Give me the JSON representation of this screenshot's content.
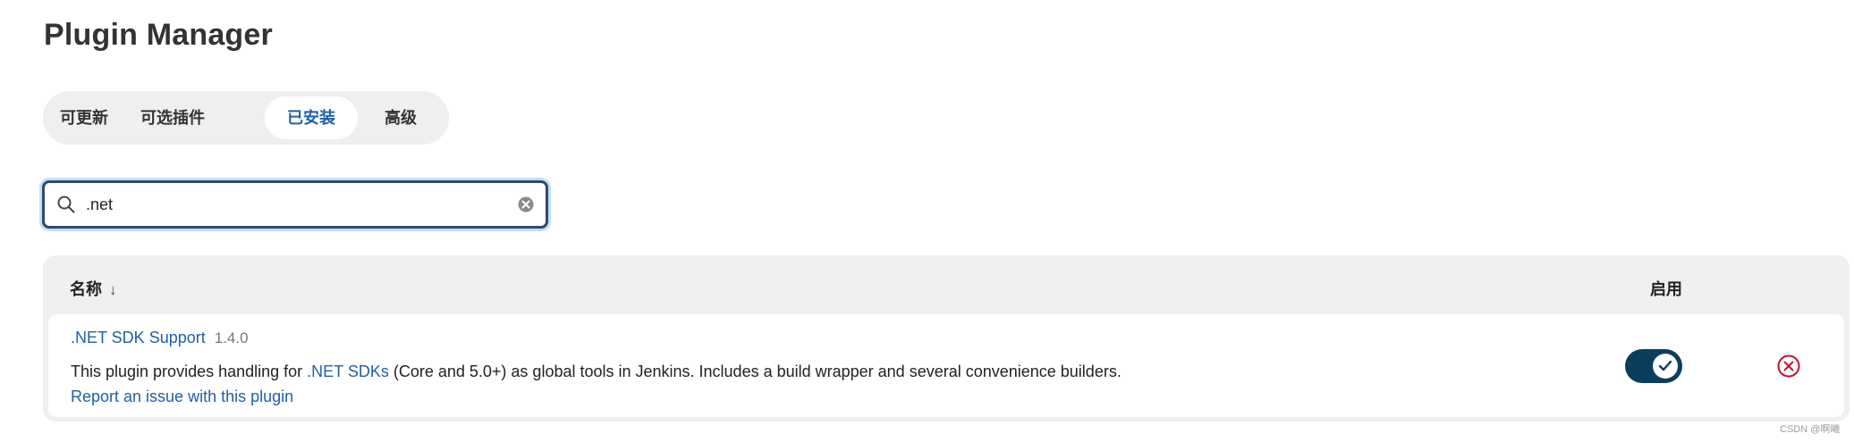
{
  "page": {
    "title": "Plugin Manager"
  },
  "tabs": [
    {
      "label": "可更新",
      "active": false
    },
    {
      "label": "可选插件",
      "active": false
    },
    {
      "label": "已安装",
      "active": true
    },
    {
      "label": "高级",
      "active": false
    }
  ],
  "search": {
    "value": ".net",
    "placeholder": ""
  },
  "table": {
    "headers": {
      "name": "名称",
      "sort_indicator": "↓",
      "enabled": "启用"
    },
    "rows": [
      {
        "name": ".NET SDK Support",
        "version": "1.4.0",
        "description_before": "This plugin provides handling for ",
        "description_link": ".NET SDKs",
        "description_after": " (Core and 5.0+) as global tools in Jenkins. Includes a build wrapper and several convenience builders.",
        "report_link": "Report an issue with this plugin",
        "enabled": true
      }
    ]
  },
  "watermark": "CSDN @啊曦",
  "colors": {
    "accent": "#1f5fa8",
    "toggle_on": "#0b3d5c",
    "uninstall": "#c8102e",
    "search_border": "#2d4a70",
    "search_focus_ring": "#bfe0f3"
  },
  "icons": {
    "search": "search-icon",
    "clear": "clear-icon",
    "check": "check-icon",
    "uninstall": "uninstall-icon"
  }
}
